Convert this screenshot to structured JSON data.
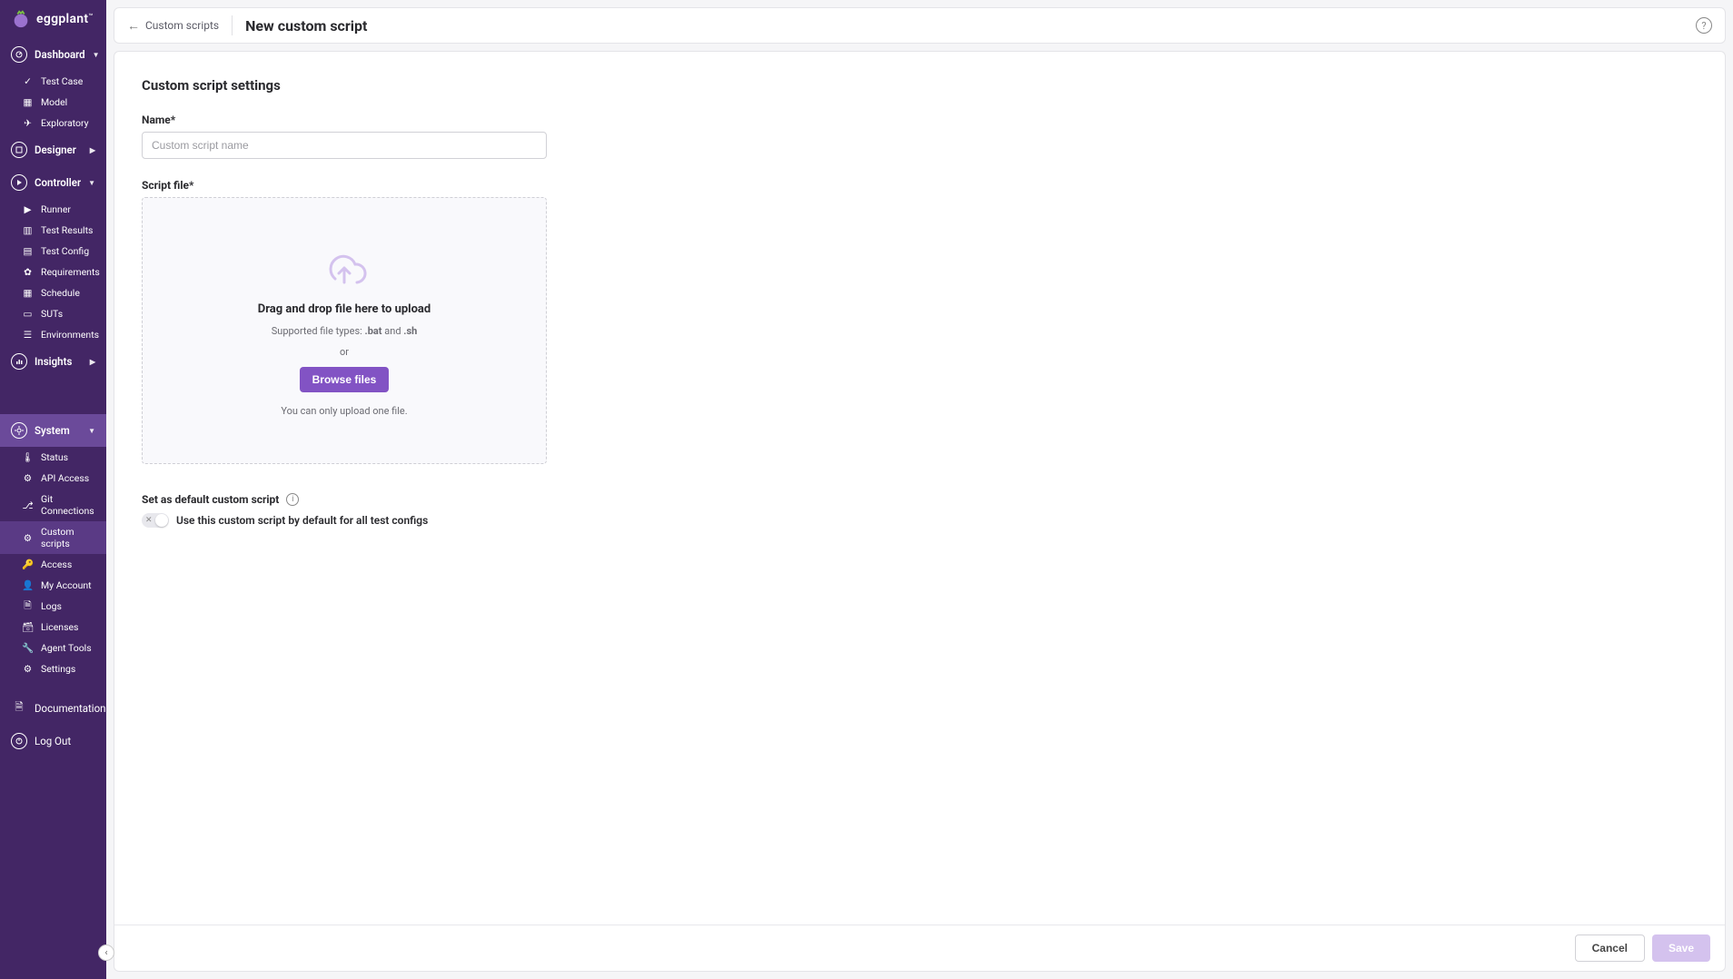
{
  "logo": {
    "text": "eggplant"
  },
  "sidebar": {
    "dashboard": {
      "label": "Dashboard",
      "items": [
        "Test Case",
        "Model",
        "Exploratory"
      ]
    },
    "designer": {
      "label": "Designer"
    },
    "controller": {
      "label": "Controller",
      "items": [
        "Runner",
        "Test Results",
        "Test Config",
        "Requirements",
        "Schedule",
        "SUTs",
        "Environments"
      ]
    },
    "insights": {
      "label": "Insights"
    },
    "system": {
      "label": "System",
      "items": [
        "Status",
        "API Access",
        "Git Connections",
        "Custom scripts",
        "Access",
        "My Account",
        "Logs",
        "Licenses",
        "Agent Tools",
        "Settings"
      ]
    },
    "documentation": {
      "label": "Documentation"
    },
    "logout": {
      "label": "Log Out"
    }
  },
  "breadcrumb": {
    "parent": "Custom scripts"
  },
  "page": {
    "title": "New custom script"
  },
  "form": {
    "section_title": "Custom script settings",
    "name_label": "Name*",
    "name_placeholder": "Custom script name",
    "script_label": "Script file*",
    "dropzone": {
      "title": "Drag and drop file here to upload",
      "sub_prefix": "Supported file types: ",
      "sub_types": ".bat",
      "sub_and": " and ",
      "sub_types2": ".sh",
      "or": "or",
      "browse": "Browse files",
      "note": "You can only upload one file."
    },
    "default": {
      "title": "Set as default custom script",
      "label": "Use this custom script by default for all test configs"
    }
  },
  "footer": {
    "cancel": "Cancel",
    "save": "Save"
  }
}
